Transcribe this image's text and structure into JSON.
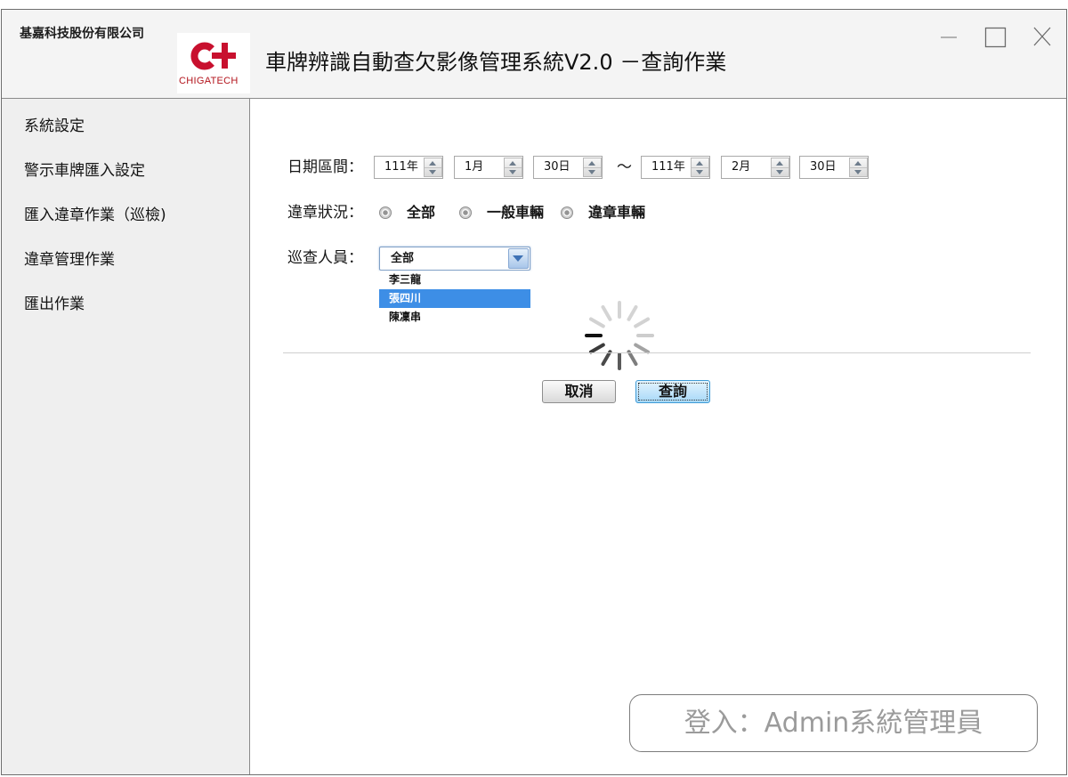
{
  "window": {
    "company_name": "基嘉科技股份有限公司",
    "logo_text": "CHIGATECH",
    "title": "車牌辨識自動查欠影像管理系統V2.0 －查詢作業",
    "controls": [
      "minimize-icon",
      "maximize-icon",
      "close-icon"
    ]
  },
  "sidebar": {
    "items": [
      {
        "label": "系統設定"
      },
      {
        "label": "警示車牌匯入設定"
      },
      {
        "label": "匯入違章作業（巡檢)"
      },
      {
        "label": "違章管理作業"
      },
      {
        "label": "匯出作業"
      }
    ]
  },
  "form": {
    "date_range": {
      "label": "日期區間：",
      "start": {
        "year": "111年",
        "month": "1月",
        "day": "30日"
      },
      "separator": "～",
      "end": {
        "year": "111年",
        "month": "2月",
        "day": "30日"
      }
    },
    "violation_status": {
      "label": "違章狀況：",
      "options": [
        {
          "label": "全部"
        },
        {
          "label": "一般車輛"
        },
        {
          "label": "違章車輛"
        }
      ]
    },
    "inspector": {
      "label": "巡查人員：",
      "selected": "全部",
      "dropdown_options": [
        {
          "label": "李三龍",
          "highlighted": false
        },
        {
          "label": "張四川",
          "highlighted": true
        },
        {
          "label": "陳凜串",
          "highlighted": false
        }
      ]
    }
  },
  "loading_indicator": {
    "icon": "loading-spinner-icon"
  },
  "buttons": {
    "cancel": "取消",
    "query": "查詢"
  },
  "login_status": "登入：Admin系統管理員",
  "colors": {
    "brand_red": "#c8102e",
    "highlight_blue": "#3d8ee6",
    "query_button_blue": "#a6d8f8",
    "login_text_gray": "#9b9b9b"
  }
}
